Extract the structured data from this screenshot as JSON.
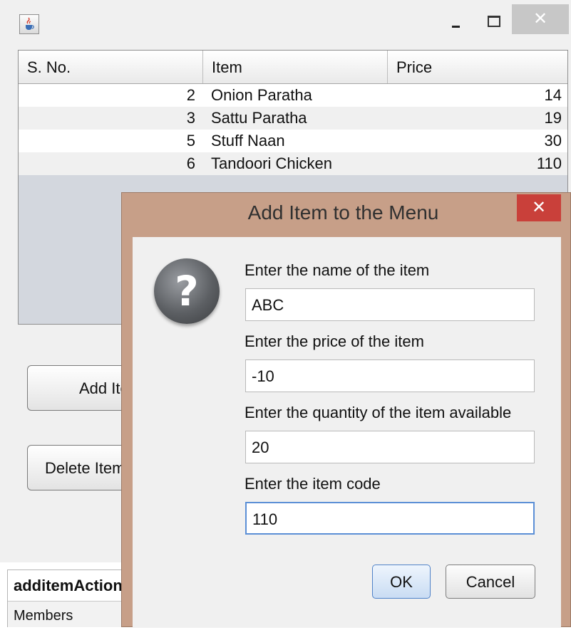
{
  "window": {
    "title": "",
    "close_glyph": "✕",
    "icon": "java-cup-icon"
  },
  "table": {
    "headers": [
      "S. No.",
      "Item",
      "Price"
    ],
    "rows": [
      {
        "sno": "2",
        "item": "Onion Paratha",
        "price": "14"
      },
      {
        "sno": "3",
        "item": "Sattu Paratha",
        "price": "19"
      },
      {
        "sno": "5",
        "item": "Stuff Naan",
        "price": "30"
      },
      {
        "sno": "6",
        "item": "Tandoori Chicken",
        "price": "110"
      }
    ]
  },
  "buttons": {
    "add_item": "Add Item",
    "delete_item": "Delete Item"
  },
  "ide": {
    "action": "additemAction",
    "members": "Members"
  },
  "dialog": {
    "title": "Add Item to the Menu",
    "close_glyph": "✕",
    "icon": "question-icon",
    "question_glyph": "?",
    "fields": [
      {
        "label": "Enter the name of the item",
        "value": "ABC"
      },
      {
        "label": "Enter the price of the item",
        "value": "-10"
      },
      {
        "label": "Enter the quantity of the item available",
        "value": "20"
      },
      {
        "label": "Enter the item code",
        "value": "110"
      }
    ],
    "ok": "OK",
    "cancel": "Cancel"
  },
  "colors": {
    "dialog_frame": "#c79f88",
    "dialog_close": "#c9403a",
    "focus_border": "#5b8fd6"
  }
}
